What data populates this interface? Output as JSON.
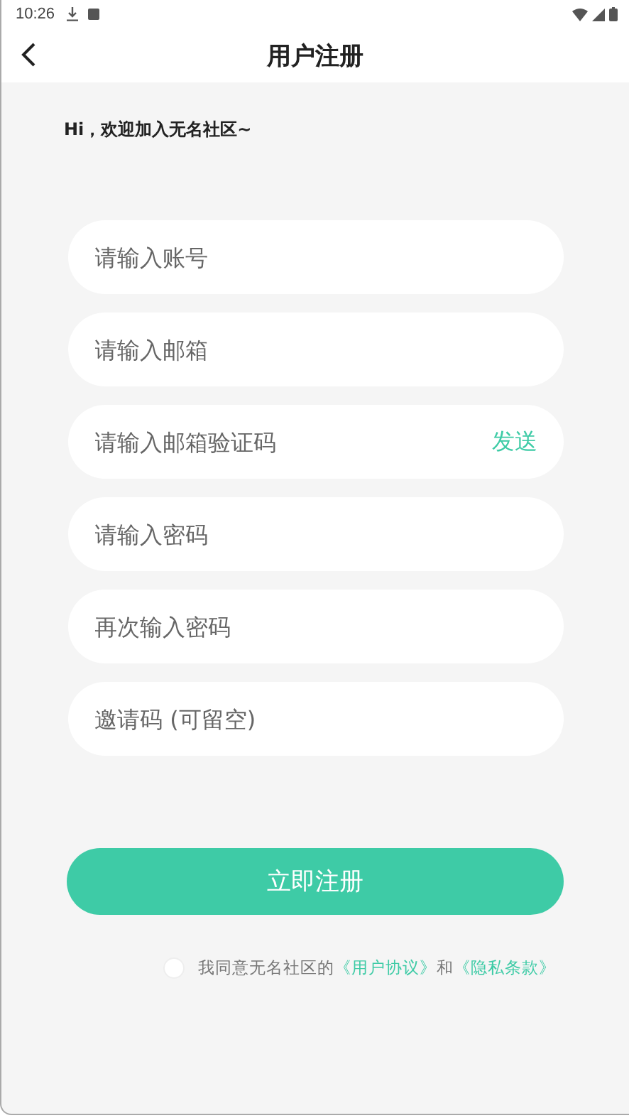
{
  "status_bar": {
    "time": "10:26"
  },
  "header": {
    "title": "用户注册"
  },
  "greeting": "Hi，欢迎加入无名社区~",
  "fields": [
    {
      "kind": "input",
      "placeholder": "请输入账号"
    },
    {
      "kind": "input",
      "placeholder": "请输入邮箱"
    },
    {
      "kind": "code",
      "placeholder": "请输入邮箱验证码",
      "action": "发送"
    },
    {
      "kind": "input",
      "placeholder": "请输入密码"
    },
    {
      "kind": "input",
      "placeholder": "再次输入密码"
    },
    {
      "kind": "input",
      "placeholder": "邀请码 (可留空)"
    }
  ],
  "submit": "立即注册",
  "agreement": {
    "checked": false,
    "parts": [
      {
        "kind": "text",
        "text": "我同意无名社区的"
      },
      {
        "kind": "link",
        "text": "《用户协议》"
      },
      {
        "kind": "text",
        "text": "和"
      },
      {
        "kind": "link",
        "text": "《隐私条款》"
      }
    ]
  }
}
